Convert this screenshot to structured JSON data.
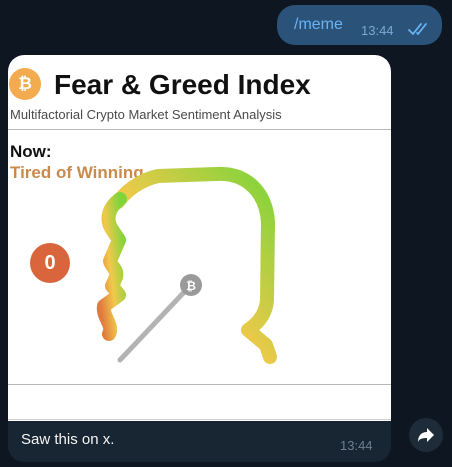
{
  "outgoing_message": {
    "text": "/meme",
    "time": "13:44",
    "status_icon": "double-check-icon"
  },
  "incoming_message": {
    "media": {
      "logo_icon": "bitcoin-icon",
      "logo_glyph": "₿",
      "title": "Fear & Greed Index",
      "subtitle": "Multifactorial Crypto Market Sentiment Analysis",
      "now_label": "Now:",
      "status": "Tired of Winning",
      "score": "0",
      "colors": {
        "status_text": "#c98a4a",
        "score_badge": "#d8653c",
        "gauge_fear": "#e07a3f",
        "gauge_mid": "#f1c94b",
        "gauge_greed": "#7ed43a"
      }
    },
    "caption": "Saw this on x.",
    "time": "13:44"
  },
  "actions": {
    "share_icon": "forward-arrow-icon"
  },
  "theme": {
    "background": "#0e1621",
    "outgoing_bubble": "#2b5278",
    "incoming_bubble": "#182533"
  }
}
